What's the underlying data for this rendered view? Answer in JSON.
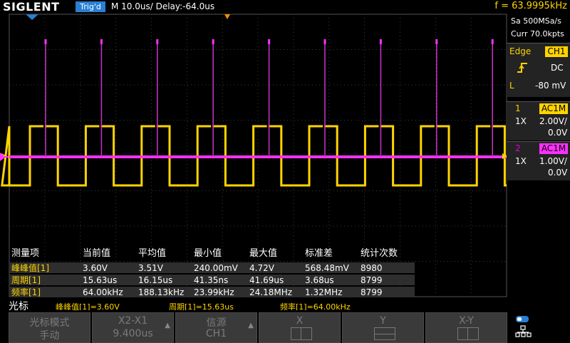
{
  "header": {
    "brand": "SIGLENT",
    "trigger_status": "Trig'd",
    "timebase": "M 10.0us/  Delay:-64.0us",
    "frequency": "f = 63.9995kHz"
  },
  "right_panel": {
    "sample_rate": "Sa 500MSa/s",
    "memory_depth": "Curr 70.0kpts",
    "trigger": {
      "type": "Edge",
      "source": "CH1",
      "slope_icon": "rising-edge-icon",
      "coupling": "DC",
      "level_label": "L",
      "level": "-80 mV"
    },
    "channels": [
      {
        "num": "1",
        "coupling": "AC1M",
        "probe": "1X",
        "scale": "2.00V/",
        "offset": "0.0V",
        "color": "#ffd400"
      },
      {
        "num": "2",
        "coupling": "AC1M",
        "probe": "1X",
        "scale": "1.00V/",
        "offset": "0.0V",
        "color": "#ff30ff"
      }
    ]
  },
  "measurements": {
    "headers": [
      "测量项",
      "当前值",
      "平均值",
      "最小值",
      "最大值",
      "标准差",
      "统计次数"
    ],
    "rows": [
      {
        "label": "峰峰值[1]",
        "current": "3.60V",
        "mean": "3.51V",
        "min": "240.00mV",
        "max": "4.72V",
        "std": "568.48mV",
        "count": "8980"
      },
      {
        "label": "周期[1]",
        "current": "15.63us",
        "mean": "16.15us",
        "min": "41.35ns",
        "max": "41.69us",
        "std": "3.68us",
        "count": "8799"
      },
      {
        "label": "频率[1]",
        "current": "64.00kHz",
        "mean": "188.13kHz",
        "min": "23.99kHz",
        "max": "24.18MHz",
        "std": "1.32MHz",
        "count": "8799"
      }
    ]
  },
  "cursor_bar": {
    "title": "光标",
    "items": [
      "峰峰值[1]=3.60V",
      "周期[1]=15.63us",
      "频率[1]=64.00kHz"
    ]
  },
  "softkeys": [
    {
      "line1": "光标模式",
      "line2": "手动"
    },
    {
      "line1": "X2-X1",
      "line2": "9.400us"
    },
    {
      "line1": "信源",
      "line2": "CH1"
    },
    {
      "line1": "X",
      "line2": ""
    },
    {
      "line1": "Y",
      "line2": ""
    },
    {
      "line1": "X-Y",
      "line2": ""
    }
  ],
  "waveforms": {
    "ch1": {
      "color": "#ffd400",
      "frequency_khz": 64.0,
      "amplitude_v": 3.6
    },
    "ch2": {
      "color": "#ff30ff"
    }
  }
}
